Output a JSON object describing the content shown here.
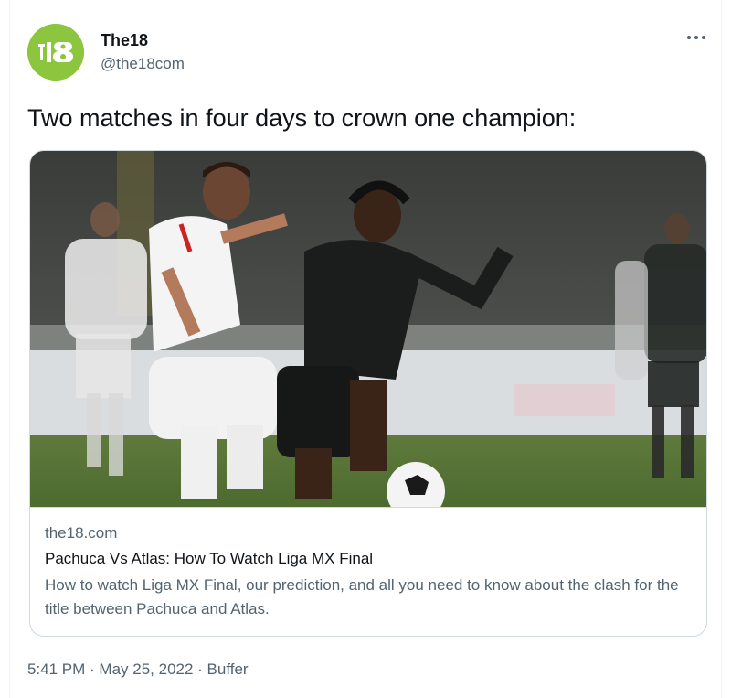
{
  "author": {
    "name": "The18",
    "handle": "@the18com",
    "avatar_icon": "the18-logo-icon",
    "avatar_color": "#8cc63f"
  },
  "menu_icon": "more-options-icon",
  "tweet_text": "Two matches in four days to crown one champion:",
  "link_card": {
    "image_description_icon": "soccer-match-photo",
    "domain": "the18.com",
    "title": "Pachuca Vs Atlas: How To Watch Liga MX Final",
    "description": "How to watch Liga MX Final, our prediction, and all you need to know about the clash for the title between Pachuca and Atlas."
  },
  "meta": {
    "time": "5:41 PM",
    "separator": " · ",
    "date": "May 25, 2022",
    "source": "Buffer"
  },
  "colors": {
    "text_primary": "#0f1419",
    "text_secondary": "#536471",
    "border": "#cfd9de"
  }
}
